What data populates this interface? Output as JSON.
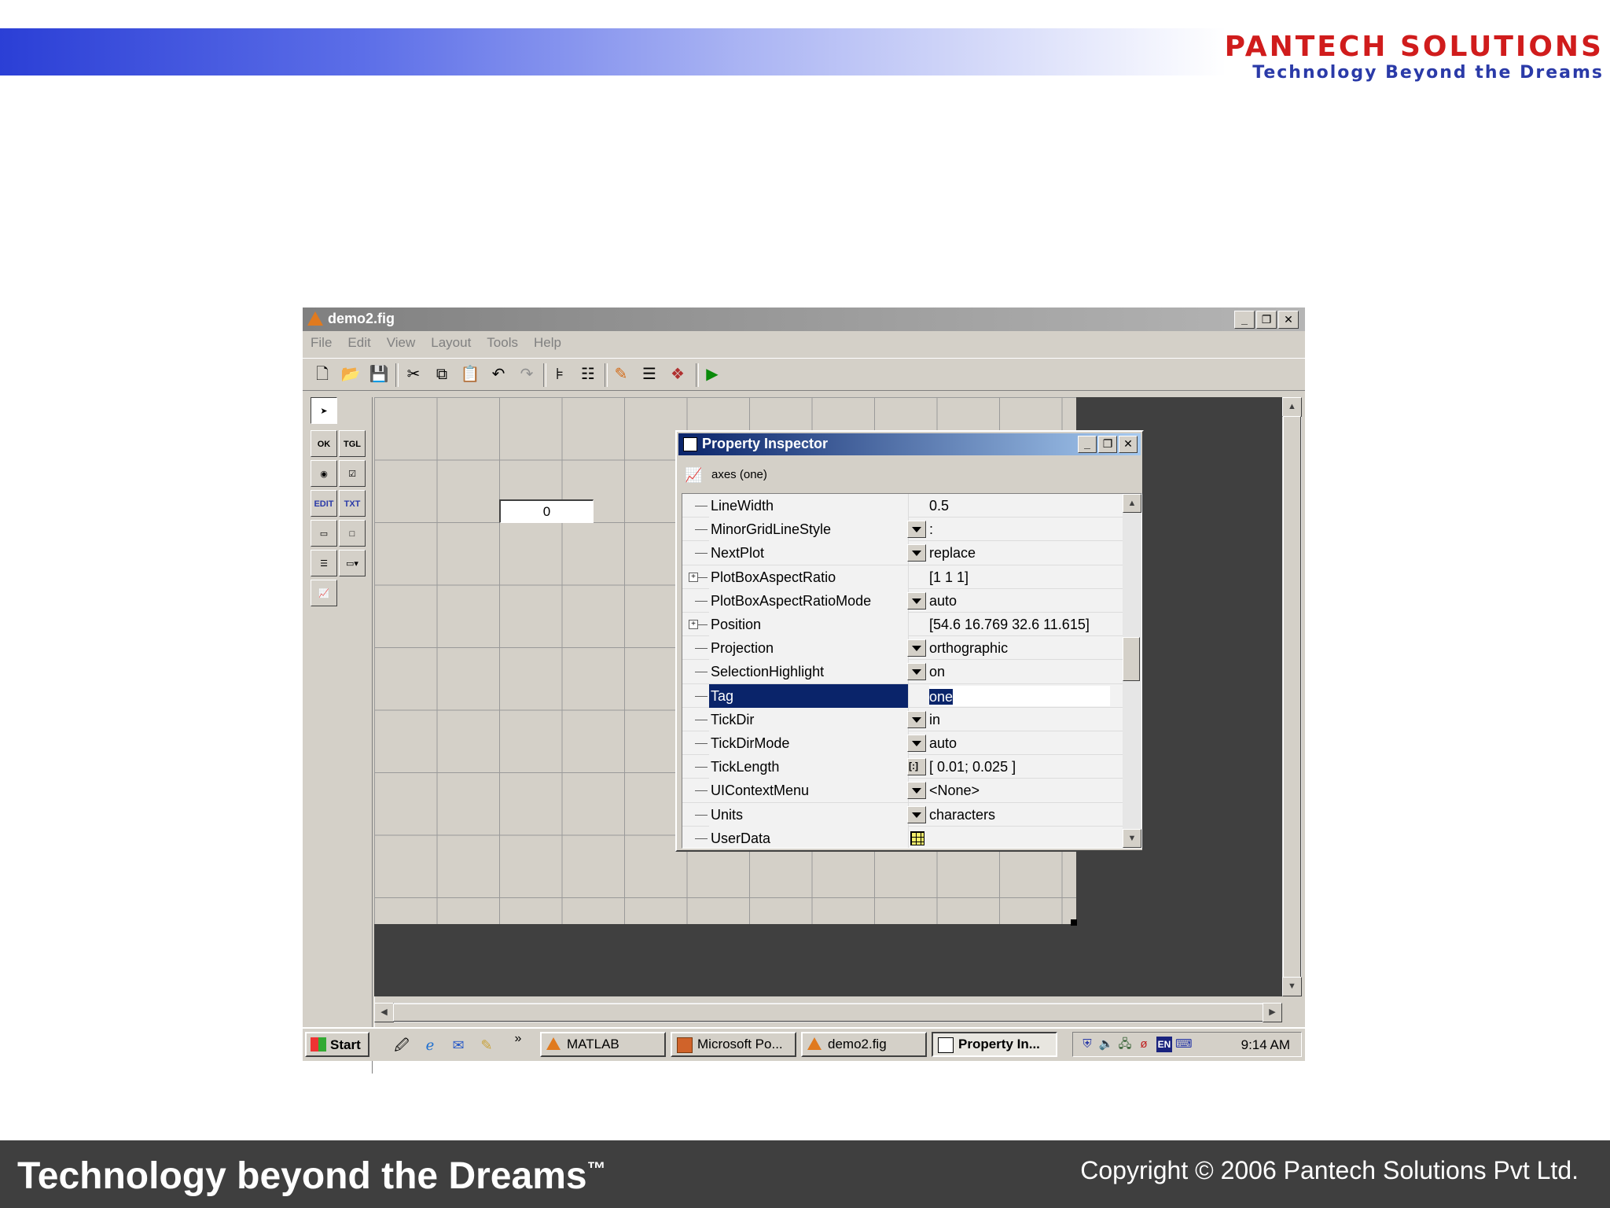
{
  "slide": {
    "logo_name": "PANTECH SOLUTIONS",
    "logo_tagline": "Technology Beyond the Dreams",
    "footer_tagline": "Technology beyond the Dreams",
    "footer_trademark": "™",
    "footer_copyright": "Copyright © 2006 Pantech Solutions Pvt Ltd."
  },
  "guide_window": {
    "title": "demo2.fig",
    "menu": [
      "File",
      "Edit",
      "View",
      "Layout",
      "Tools",
      "Help"
    ],
    "window_buttons": {
      "minimize": "_",
      "restore": "❐",
      "close": "✕"
    }
  },
  "palette": {
    "items": [
      {
        "name": "select-tool",
        "label": "➤"
      },
      {
        "name": "push-button-tool",
        "label": "OK"
      },
      {
        "name": "toggle-button-tool",
        "label": "TGL"
      },
      {
        "name": "radio-button-tool",
        "label": "◉"
      },
      {
        "name": "checkbox-tool",
        "label": "☑"
      },
      {
        "name": "edit-text-tool",
        "label": "EDIT"
      },
      {
        "name": "static-text-tool",
        "label": "TXT"
      },
      {
        "name": "slider-tool",
        "label": "▭"
      },
      {
        "name": "frame-tool",
        "label": "□"
      },
      {
        "name": "listbox-tool",
        "label": "☰"
      },
      {
        "name": "popup-menu-tool",
        "label": "▭▾"
      },
      {
        "name": "axes-tool",
        "label": "📈"
      }
    ]
  },
  "canvas": {
    "edit_box_value": "0"
  },
  "property_inspector": {
    "title": "Property Inspector",
    "object_label": "axes (one)",
    "rows": [
      {
        "name": "LineWidth",
        "control": "none",
        "expandable": false,
        "value": "0.5"
      },
      {
        "name": "MinorGridLineStyle",
        "control": "dropdown",
        "expandable": false,
        "value": ":"
      },
      {
        "name": "NextPlot",
        "control": "dropdown",
        "expandable": false,
        "value": "replace"
      },
      {
        "name": "PlotBoxAspectRatio",
        "control": "none",
        "expandable": true,
        "value": "[1 1 1]"
      },
      {
        "name": "PlotBoxAspectRatioMode",
        "control": "dropdown",
        "expandable": false,
        "value": "auto"
      },
      {
        "name": "Position",
        "control": "none",
        "expandable": true,
        "value": "[54.6 16.769 32.6 11.615]"
      },
      {
        "name": "Projection",
        "control": "dropdown",
        "expandable": false,
        "value": "orthographic"
      },
      {
        "name": "SelectionHighlight",
        "control": "dropdown",
        "expandable": false,
        "value": "on"
      },
      {
        "name": "Tag",
        "control": "none",
        "expandable": false,
        "value": "one",
        "selected": true
      },
      {
        "name": "TickDir",
        "control": "dropdown",
        "expandable": false,
        "value": "in"
      },
      {
        "name": "TickDirMode",
        "control": "dropdown",
        "expandable": false,
        "value": "auto"
      },
      {
        "name": "TickLength",
        "control": "array",
        "expandable": false,
        "value": "[ 0.01; 0.025 ]"
      },
      {
        "name": "UIContextMenu",
        "control": "dropdown",
        "expandable": false,
        "value": "<None>"
      },
      {
        "name": "Units",
        "control": "dropdown",
        "expandable": false,
        "value": "characters"
      },
      {
        "name": "UserData",
        "control": "grid",
        "expandable": false,
        "value": ""
      }
    ]
  },
  "taskbar": {
    "start_label": "Start",
    "overflow": "»",
    "tasks": [
      {
        "label": "MATLAB",
        "active": false
      },
      {
        "label": "Microsoft Po...",
        "active": false
      },
      {
        "label": "demo2.fig",
        "active": false
      },
      {
        "label": "Property In...",
        "active": true
      }
    ],
    "language": "EN",
    "clock": "9:14 AM"
  },
  "colors": {
    "title_active_start": "#0a246a",
    "title_active_end": "#a6caf0",
    "selection": "#0a246a",
    "logo_red": "#d01c1c",
    "logo_blue": "#2a3aa8"
  }
}
